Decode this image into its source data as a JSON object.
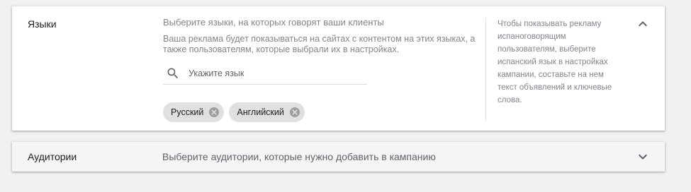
{
  "languages": {
    "title": "Языки",
    "prompt": "Выберите языки, на которых говорят ваши клиенты",
    "description": "Ваша реклама будет показываться на сайтах с контентом на этих языках, а также пользователям, которые выбрали их в настройках.",
    "search": {
      "placeholder": "Укажите язык",
      "value": "",
      "icon": "search-icon"
    },
    "chips": [
      {
        "label": "Русский",
        "icon": "cancel-icon"
      },
      {
        "label": "Английский",
        "icon": "cancel-icon"
      }
    ],
    "tip": "Чтобы показывать рекламу испаноговорящим пользователям, выберите испанский язык в настройках кампании, составьте на нем текст объявлений и ключевые слова.",
    "toggle_icon": "chevron-up-icon"
  },
  "audiences": {
    "title": "Аудитории",
    "description": "Выберите аудитории, которые нужно добавить в кампанию",
    "toggle_icon": "chevron-down-icon"
  },
  "colors": {
    "background": "#f1f1f1",
    "card": "#ffffff",
    "chip": "#e0e0e0",
    "muted_text": "#80868b"
  }
}
